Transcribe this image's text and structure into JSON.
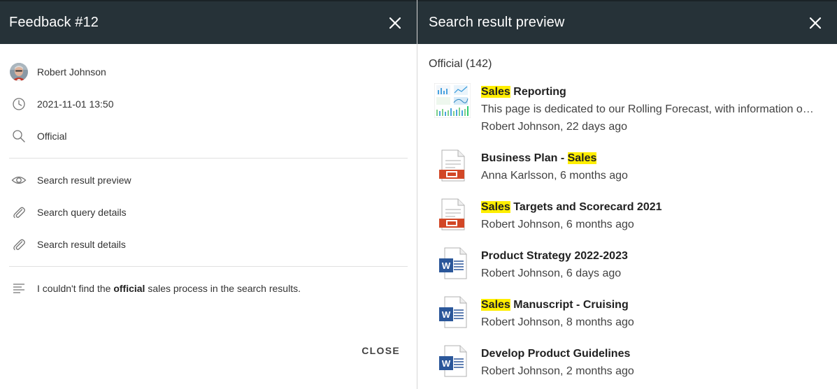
{
  "left_panel": {
    "title": "Feedback #12",
    "user": "Robert Johnson",
    "timestamp": "2021-11-01 13:50",
    "query": "Official",
    "links": [
      {
        "label": "Search result preview",
        "icon": "eye-icon"
      },
      {
        "label": "Search query details",
        "icon": "paperclip-icon"
      },
      {
        "label": "Search result details",
        "icon": "paperclip-icon"
      }
    ],
    "comment": {
      "before": "I couldn't find the ",
      "bold": "official",
      "after": " sales process in the search results."
    },
    "close_label": "CLOSE"
  },
  "right_panel": {
    "title": "Search result preview",
    "count_label": "Official (142)",
    "highlight_color": "#ffee00",
    "results": [
      {
        "thumb": "dashboard-thumbnail",
        "title_parts": [
          {
            "text": "Sales",
            "hl": true
          },
          {
            "text": " Reporting",
            "hl": false
          }
        ],
        "description": "This page is dedicated to our Rolling Forecast, with information on the latest updates and reports for the sales teams",
        "meta": "Robert Johnson, 22 days ago"
      },
      {
        "thumb": "presentation-file-icon",
        "title_parts": [
          {
            "text": "Business Plan - ",
            "hl": false
          },
          {
            "text": "Sales",
            "hl": true
          }
        ],
        "meta": "Anna Karlsson, 6 months ago"
      },
      {
        "thumb": "presentation-file-icon",
        "title_parts": [
          {
            "text": "Sales",
            "hl": true
          },
          {
            "text": " Targets and Scorecard 2021",
            "hl": false
          }
        ],
        "meta": "Robert Johnson, 6 months ago"
      },
      {
        "thumb": "word-file-icon",
        "title_parts": [
          {
            "text": "Product Strategy 2022-2023",
            "hl": false
          }
        ],
        "meta": "Robert Johnson, 6 days ago"
      },
      {
        "thumb": "word-file-icon",
        "title_parts": [
          {
            "text": "Sales",
            "hl": true
          },
          {
            "text": " Manuscript - Cruising",
            "hl": false
          }
        ],
        "meta": "Robert Johnson, 8 months ago"
      },
      {
        "thumb": "word-file-icon",
        "title_parts": [
          {
            "text": "Develop Product Guidelines",
            "hl": false
          }
        ],
        "meta": "Robert Johnson, 2 months ago"
      }
    ]
  }
}
